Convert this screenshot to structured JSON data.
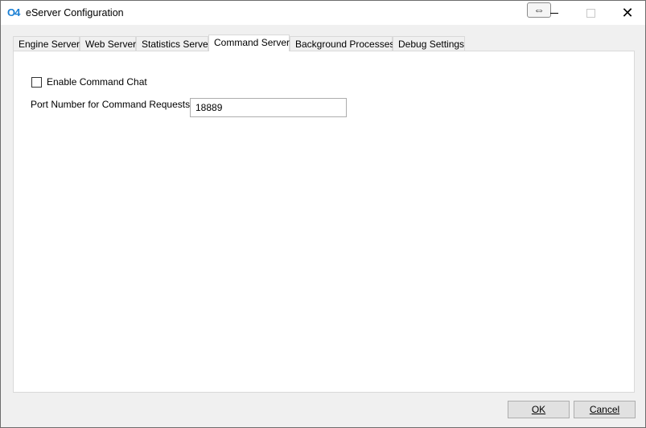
{
  "window": {
    "title": "eServer Configuration",
    "icon_text": "O4",
    "resize_glyph": "⇔",
    "close_glyph": "✕"
  },
  "tabs": [
    {
      "label": "Engine Server"
    },
    {
      "label": "Web Server"
    },
    {
      "label": "Statistics Server"
    },
    {
      "label": "Command Server"
    },
    {
      "label": "Background Processes"
    },
    {
      "label": "Debug Settings"
    }
  ],
  "active_tab": "Command Server",
  "command_server": {
    "enable_chat_label": "Enable Command Chat",
    "enable_chat_checked": false,
    "port_label": "Port Number for Command Requests:",
    "port_value": "18889"
  },
  "buttons": {
    "ok_label": "OK",
    "cancel_label": "Cancel"
  },
  "colors": {
    "app_icon": "#1a7fd4",
    "dialog_background": "#f0f0f0",
    "panel_background": "#ffffff"
  }
}
